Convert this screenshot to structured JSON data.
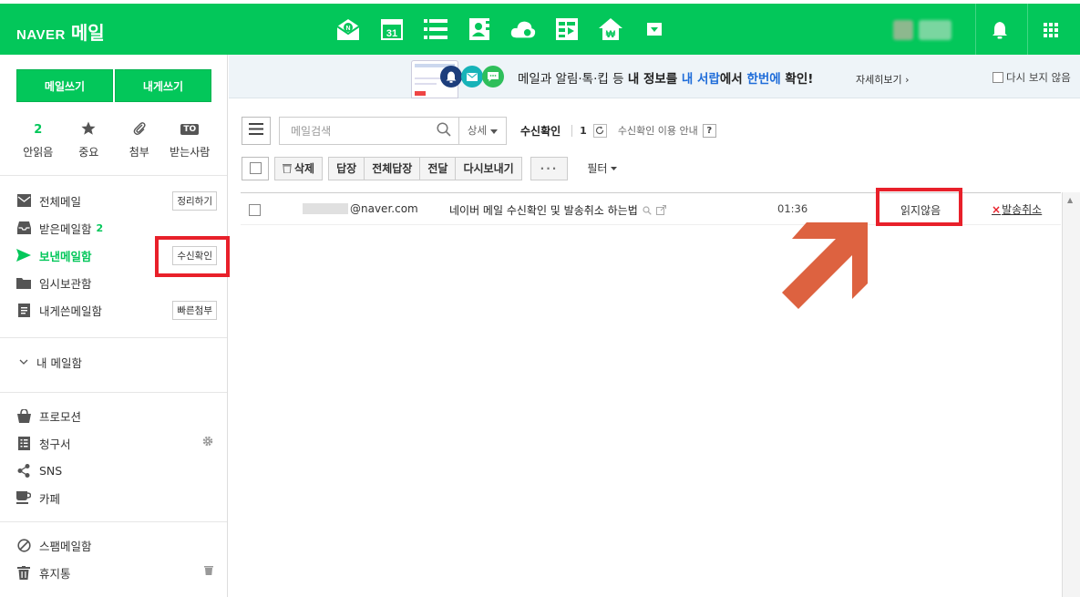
{
  "header": {
    "brand": "NAVER",
    "service": "메일",
    "colors": {
      "brand_green": "#03c75a",
      "highlight_red": "#e8202a",
      "arrow_orange": "#dd6240"
    },
    "apps": [
      {
        "name": "mail-app-icon",
        "glyph": "N"
      },
      {
        "name": "calendar-app-icon",
        "glyph": "31"
      },
      {
        "name": "todo-app-icon",
        "glyph": ""
      },
      {
        "name": "contacts-app-icon",
        "glyph": ""
      },
      {
        "name": "cloud-app-icon",
        "glyph": ""
      },
      {
        "name": "memo-app-icon",
        "glyph": ""
      },
      {
        "name": "household-app-icon",
        "glyph": "₩"
      },
      {
        "name": "more-apps-dropdown-icon",
        "glyph": ""
      }
    ]
  },
  "sidebar": {
    "write_mail": "메일쓰기",
    "write_self": "내게쓰기",
    "quick": [
      {
        "top": "2",
        "label": "안읽음"
      },
      {
        "top": "star-icon",
        "label": "중요"
      },
      {
        "top": "paperclip-icon",
        "label": "첨부"
      },
      {
        "top": "TO",
        "label": "받는사람"
      }
    ],
    "folders": [
      {
        "label": "전체메일",
        "button": "정리하기"
      },
      {
        "label": "받은메일함",
        "count": "2"
      },
      {
        "label": "보낸메일함",
        "button": "수신확인"
      },
      {
        "label": "임시보관함"
      },
      {
        "label": "내게쓴메일함",
        "button": "빠른첨부"
      }
    ],
    "my_folders": "내 메일함",
    "extras": [
      {
        "label": "프로모션"
      },
      {
        "label": "청구서"
      },
      {
        "label": "SNS"
      },
      {
        "label": "카페"
      }
    ],
    "bottom": [
      {
        "label": "스팸메일함"
      },
      {
        "label": "휴지통"
      }
    ]
  },
  "banner": {
    "msg_pre": "메일과 알림·톡·킵 등 ",
    "msg_b1": "내 정보를 ",
    "msg_blue1": "내 서랍",
    "msg_mid": "에서 ",
    "msg_blue2": "한번에",
    "msg_end": " 확인!",
    "detail": "자세히보기 ›",
    "no_show": "다시 보지 않음"
  },
  "toolbar": {
    "search_placeholder": "메일검색",
    "detail": "상세",
    "receipt_label": "수신확인",
    "receipt_count": "1",
    "receipt_guide": "수신확인 이용 안내",
    "help": "?",
    "delete": "삭제",
    "reply": "답장",
    "reply_all": "전체답장",
    "forward": "전달",
    "resend": "다시보내기",
    "more": "···",
    "filter": "필터"
  },
  "mail_list": [
    {
      "sender": "@naver.com",
      "subject": "네이버 메일 수신확인 및 발송취소 하는법",
      "time": "01:36",
      "status": "읽지않음",
      "cancel": "발송취소"
    }
  ]
}
